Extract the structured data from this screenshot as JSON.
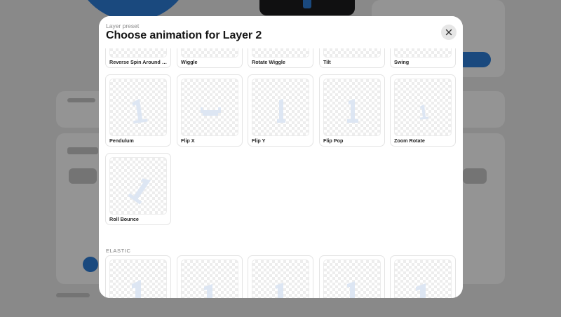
{
  "modal": {
    "eyebrow": "Layer preset",
    "title": "Choose animation for Layer 2",
    "close_icon": "close-icon"
  },
  "presets_top": [
    {
      "label": "Reverse Spin Around C..."
    },
    {
      "label": "Wiggle"
    },
    {
      "label": "Rotate Wiggle"
    },
    {
      "label": "Tilt"
    },
    {
      "label": "Swing"
    }
  ],
  "presets_middle": [
    {
      "label": "Pendulum"
    },
    {
      "label": "Flip X"
    },
    {
      "label": "Flip Y"
    },
    {
      "label": "Flip Pop"
    },
    {
      "label": "Zoom Rotate"
    }
  ],
  "presets_last": [
    {
      "label": "Roll Bounce"
    }
  ],
  "sections": {
    "elastic_label": "ELASTIC"
  },
  "colors": {
    "glyph": "#dde6f3",
    "accent": "#2e7fd9",
    "overlay": "rgba(0,0,0,0.42)"
  }
}
